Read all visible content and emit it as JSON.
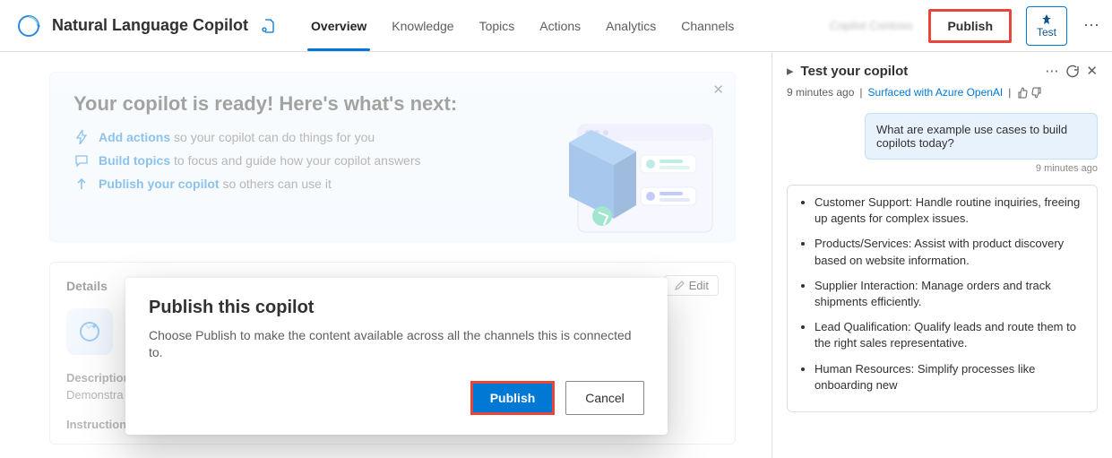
{
  "header": {
    "app_title": "Natural Language Copilot",
    "tabs": [
      "Overview",
      "Knowledge",
      "Topics",
      "Actions",
      "Analytics",
      "Channels"
    ],
    "active_tab_index": 0,
    "blurred_label": "Copilot Contoso",
    "publish_label": "Publish",
    "test_label": "Test"
  },
  "banner": {
    "title": "Your copilot is ready! Here's what's next:",
    "steps": [
      {
        "link": "Add actions",
        "rest": " so your copilot can do things for you"
      },
      {
        "link": "Build topics",
        "rest": " to focus and guide how your copilot answers"
      },
      {
        "link": "Publish your copilot",
        "rest": " so others can use it"
      }
    ]
  },
  "details": {
    "panel_title": "Details",
    "edit_label": "Edit",
    "description_label": "Description",
    "description_value": "Demonstra",
    "instructions_label": "Instructions"
  },
  "modal": {
    "title": "Publish this copilot",
    "text": "Choose Publish to make the content available across all the channels this is connected to.",
    "primary": "Publish",
    "secondary": "Cancel"
  },
  "side": {
    "title": "Test your copilot",
    "timestamp": "9 minutes ago",
    "source_label": "Surfaced with Azure OpenAI",
    "user_message": "What are example use cases to build copilots today?",
    "reply_time": "9 minutes ago",
    "bot_items": [
      "Customer Support: Handle routine inquiries, freeing up agents for complex issues.",
      "Products/Services: Assist with product discovery based on website information.",
      "Supplier Interaction: Manage orders and track shipments efficiently.",
      "Lead Qualification: Qualify leads and route them to the right sales representative.",
      "Human Resources: Simplify processes like onboarding new"
    ]
  }
}
